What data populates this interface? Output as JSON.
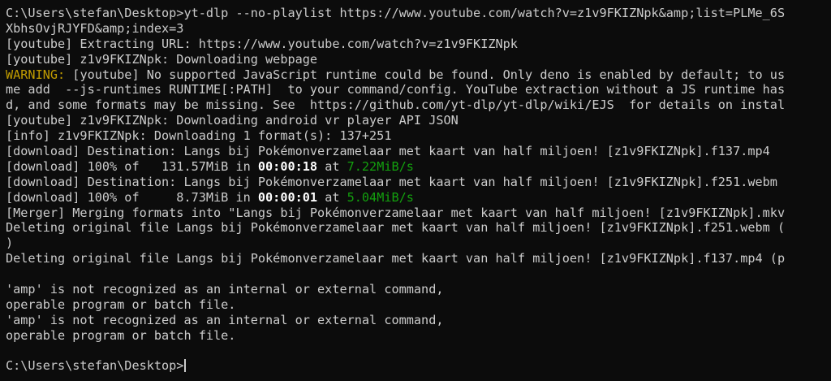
{
  "terminal": {
    "colors": {
      "background": "#0c0c0c",
      "foreground": "#cccccc",
      "warning": "#c19c00",
      "speed": "#13a10e",
      "time": "#ffffff"
    },
    "lines": [
      {
        "text": "C:\\Users\\stefan\\Desktop>yt-dlp --no-playlist https://www.youtube.com/watch?v=z1v9FKIZNpk&amp;list=PLMe_6S"
      },
      {
        "text": "XbhsOvjRJYFD&amp;index=3"
      },
      {
        "text": "[youtube] Extracting URL: https://www.youtube.com/watch?v=z1v9FKIZNpk"
      },
      {
        "text": "[youtube] z1v9FKIZNpk: Downloading webpage"
      },
      {
        "prefix": "WARNING:",
        "text": " [youtube] No supported JavaScript runtime could be found. Only deno is enabled by default; to us"
      },
      {
        "text": "me add  --js-runtimes RUNTIME[:PATH]  to your command/config. YouTube extraction without a JS runtime has"
      },
      {
        "text": "d, and some formats may be missing. See  https://github.com/yt-dlp/yt-dlp/wiki/EJS  for details on instal"
      },
      {
        "text": "[youtube] z1v9FKIZNpk: Downloading android vr player API JSON"
      },
      {
        "text": "[info] z1v9FKIZNpk: Downloading 1 format(s): 137+251"
      },
      {
        "text": "[download] Destination: Langs bij Pokémonverzamelaar met kaart van half miljoen! [z1v9FKIZNpk].f137.mp4"
      },
      {
        "progress": {
          "prefix": "[download] 100% of   131.57MiB in ",
          "time": "00:00:18",
          "mid": " at ",
          "speed": "7.22MiB/s"
        }
      },
      {
        "text": "[download] Destination: Langs bij Pokémonverzamelaar met kaart van half miljoen! [z1v9FKIZNpk].f251.webm"
      },
      {
        "progress": {
          "prefix": "[download] 100% of     8.73MiB in ",
          "time": "00:00:01",
          "mid": " at ",
          "speed": "5.04MiB/s"
        }
      },
      {
        "text": "[Merger] Merging formats into \"Langs bij Pokémonverzamelaar met kaart van half miljoen! [z1v9FKIZNpk].mkv"
      },
      {
        "text": "Deleting original file Langs bij Pokémonverzamelaar met kaart van half miljoen! [z1v9FKIZNpk].f251.webm ("
      },
      {
        "text": ")"
      },
      {
        "text": "Deleting original file Langs bij Pokémonverzamelaar met kaart van half miljoen! [z1v9FKIZNpk].f137.mp4 (p"
      },
      {
        "text": ""
      },
      {
        "text": "'amp' is not recognized as an internal or external command,"
      },
      {
        "text": "operable program or batch file."
      },
      {
        "text": "'amp' is not recognized as an internal or external command,"
      },
      {
        "text": "operable program or batch file."
      },
      {
        "text": ""
      },
      {
        "text": "C:\\Users\\stefan\\Desktop>",
        "cursor": true
      }
    ]
  }
}
